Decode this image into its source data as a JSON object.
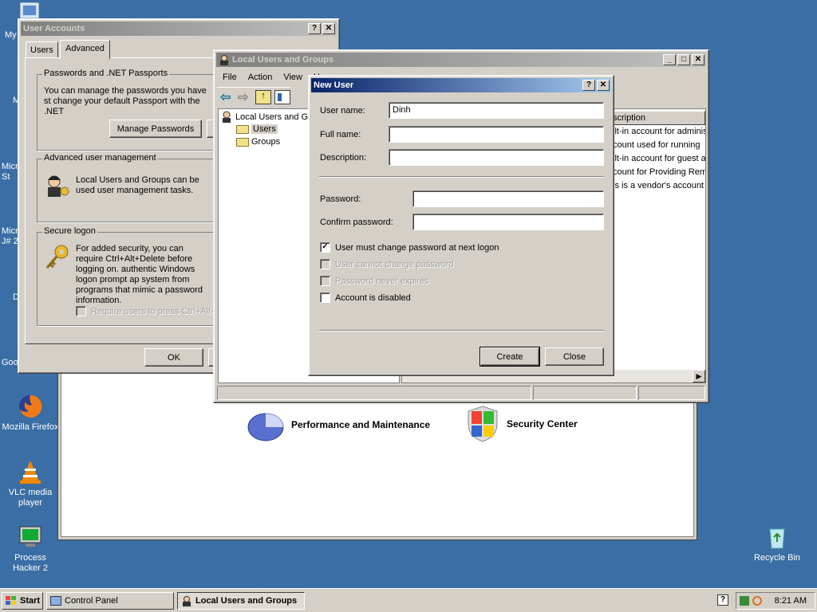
{
  "desktop": {
    "icons": [
      {
        "label": "Mozilla Firefox"
      },
      {
        "label": "VLC media player"
      },
      {
        "label": "Process Hacker 2"
      },
      {
        "label": "Recycle Bin"
      }
    ],
    "partial_labels": [
      "My",
      "M",
      "Micro St",
      "Micro J# 2",
      "D",
      "Goo"
    ]
  },
  "control_panel": {
    "items": [
      {
        "label": "Performance and Maintenance",
        "icon": "performance-icon"
      },
      {
        "label": "Security Center",
        "icon": "shield-icon"
      }
    ]
  },
  "user_accounts": {
    "title": "User Accounts",
    "tabs": [
      "Users",
      "Advanced"
    ],
    "passports": {
      "title": "Passwords and .NET Passports",
      "text": "You can manage the passwords you have st change your default Passport with the .NET",
      "button": "Manage Passwords"
    },
    "advanced_mgmt": {
      "title": "Advanced user management",
      "text": "Local Users and Groups can be used user management tasks."
    },
    "secure_logon": {
      "title": "Secure logon",
      "text": "For added security, you can require Ctrl+Alt+Delete before logging on. authentic Windows logon prompt ap system from programs that mimic a password information.",
      "checkbox": "Require users to press Ctrl+Alt-"
    },
    "ok_button": "OK"
  },
  "lusrmgr": {
    "title": "Local Users and Groups",
    "menu": [
      "File",
      "Action",
      "View",
      "H"
    ],
    "tree": {
      "root": "Local Users and Gr",
      "children": [
        "Users",
        "Groups"
      ]
    },
    "column_header": "scription",
    "rows": [
      "ilt-in account for adminis",
      "count used for running",
      "ilt-in account for guest a",
      "count for Providing Rem",
      "is is a vendor's account"
    ]
  },
  "new_user": {
    "title": "New User",
    "user_name_label": "User name:",
    "user_name_value": "Dinh",
    "full_name_label": "Full name:",
    "full_name_value": "",
    "description_label": "Description:",
    "description_value": "",
    "password_label": "Password:",
    "confirm_label": "Confirm password:",
    "checkboxes": [
      {
        "label": "User must change password at next logon",
        "checked": true,
        "enabled": true
      },
      {
        "label": "User cannot change password",
        "checked": false,
        "enabled": false
      },
      {
        "label": "Password never expires",
        "checked": false,
        "enabled": false
      },
      {
        "label": "Account is disabled",
        "checked": false,
        "enabled": true
      }
    ],
    "create_button": "Create",
    "close_button": "Close"
  },
  "taskbar": {
    "start": "Start",
    "tasks": [
      {
        "label": "Control Panel",
        "active": false
      },
      {
        "label": "Local Users and Groups",
        "active": true
      }
    ],
    "clock": "8:21 AM"
  },
  "colors": {
    "desktop": "#3a6ea5",
    "title_active": "#0a246a",
    "face": "#d4d0c8"
  }
}
